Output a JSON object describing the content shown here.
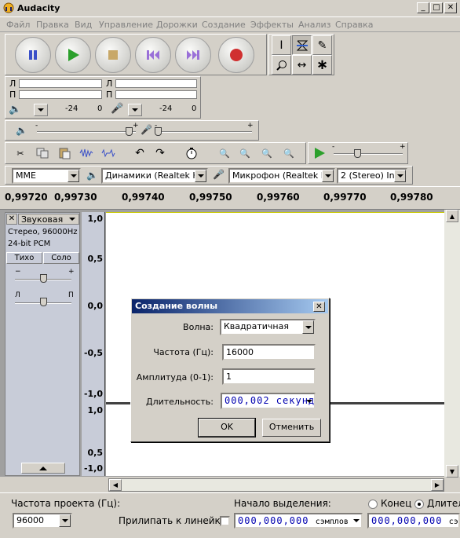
{
  "window": {
    "title": "Audacity"
  },
  "menu": [
    "Файл",
    "Правка",
    "Вид",
    "Управление",
    "Дорожки",
    "Создание",
    "Эффекты",
    "Анализ",
    "Справка"
  ],
  "meters": {
    "left_channel": "Л",
    "right_channel": "П",
    "scale_a": "-24",
    "scale_b": "0",
    "scale_c": "-24",
    "scale_d": "0"
  },
  "mixer": {
    "minus": "-",
    "plus": "+"
  },
  "devices": {
    "host": "MME",
    "output": "Динамики (Realtek High",
    "input": "Микрофон (Realtek High",
    "channels": "2 (Stereo) Inp"
  },
  "play_at_speed": {
    "minus": "-",
    "plus": "+"
  },
  "ruler": {
    "ticks": [
      "0,99720",
      "0,99730",
      "0,99740",
      "0,99750",
      "0,99760",
      "0,99770",
      "0,99780"
    ]
  },
  "track": {
    "close": "✕",
    "name": "Звуковая",
    "info1": "Стерео, 96000Hz",
    "info2": "24-bit PCM",
    "mute": "Тихо",
    "solo": "Соло",
    "gain_minus": "−",
    "gain_plus": "+",
    "pan_left": "Л",
    "pan_right": "П"
  },
  "vruler": {
    "labels": [
      "1,0",
      "0,5",
      "0,0",
      "-0,5",
      "-1,0",
      "1,0",
      "0,5",
      "-1,0"
    ]
  },
  "dialog": {
    "title": "Создание волны",
    "close": "✕",
    "wave_label": "Волна:",
    "wave_value": "Квадратичная",
    "freq_label": "Частота (Гц):",
    "freq_value": "16000",
    "amp_label": "Амплитуда (0-1):",
    "amp_value": "1",
    "dur_label": "Длительность:",
    "dur_value": "000,002 секунд",
    "ok": "OK",
    "cancel": "Отменить"
  },
  "status": {
    "rate_label": "Частота проекта (Гц):",
    "rate_value": "96000",
    "snap_label": "Прилипать к линейке",
    "sel_start_label": "Начало выделения:",
    "sel_start_value": "000,000,000",
    "sel_start_unit": "сэмплов",
    "end_label": "Конец",
    "length_label": "Длител",
    "end_value": "000,000,000",
    "end_unit": "сэ"
  },
  "colors": {
    "play": "#2ca02c",
    "record": "#d03030",
    "pause": "#3a50c8",
    "skip": "#9a70d8",
    "digits": "#0000b0"
  }
}
